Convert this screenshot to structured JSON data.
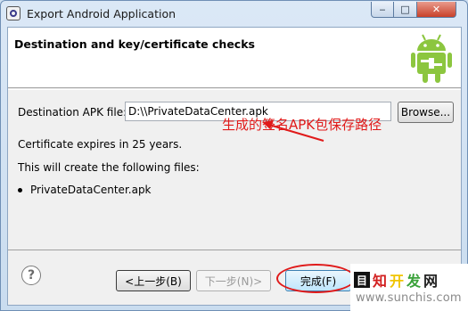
{
  "window": {
    "title": "Export Android Application",
    "controls": {
      "minimize": "‒",
      "maximize": "□",
      "close": "✕"
    }
  },
  "header": {
    "title": "Destination and key/certificate checks",
    "logo_icon": "android-icon"
  },
  "form": {
    "destination_label": "Destination APK file:",
    "destination_value": "D:\\\\PrivateDataCenter.apk",
    "browse_label": "Browse..."
  },
  "info": {
    "certificate_text": "Certificate expires in 25 years.",
    "create_text": "This will create the following files:",
    "files": [
      "PrivateDataCenter.apk"
    ]
  },
  "annotation": {
    "text": "生成的签名APK包保存路径",
    "color": "#e01a1a"
  },
  "footer": {
    "help_icon": "?",
    "back_label": "<上一步(B)",
    "next_label": "下一步(N)>",
    "finish_label": "完成(F)"
  },
  "watermark": {
    "chars": [
      "知",
      "开",
      "发",
      "网"
    ],
    "url": "www.sunchis.com"
  }
}
